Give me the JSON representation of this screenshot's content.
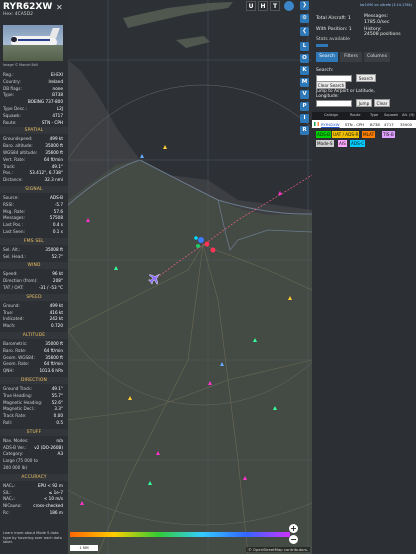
{
  "aircraft": {
    "callsign": "RYR62XW",
    "hex_label": "Hex:",
    "hex": "4CA5D2",
    "photo_credit": "Image © Marcel Brill"
  },
  "info_rows": [
    {
      "k": "Reg.:",
      "v": "EI-EXI"
    },
    {
      "k": "Country:",
      "v": "Ireland"
    },
    {
      "k": "DB flags:",
      "v": "none"
    },
    {
      "k": "Type:",
      "v": "B738"
    },
    {
      "k": "",
      "v": "BOEING 737-800"
    },
    {
      "k": "Type Desc.:",
      "v": "L2J"
    },
    {
      "k": "Squawk:",
      "v": "4717"
    },
    {
      "k": "Route:",
      "v": "STN - CPH"
    }
  ],
  "sections": {
    "spatial": {
      "title": "SPATIAL",
      "rows": [
        {
          "k": "Groundspeed:",
          "v": "499 kt"
        },
        {
          "k": "Baro. altitude:",
          "v": "35000 ft"
        },
        {
          "k": "WGS84 altitude:",
          "v": "35600 ft"
        },
        {
          "k": "Vert. Rate:",
          "v": "64 ft/min"
        },
        {
          "k": "Track:",
          "v": "49.1°"
        },
        {
          "k": "Pos.:",
          "v": "53.412°, 6.738°"
        },
        {
          "k": "Distance:",
          "v": "32.3 nmi"
        }
      ]
    },
    "signal": {
      "title": "SIGNAL",
      "rows": [
        {
          "k": "Source:",
          "v": "ADS-B"
        },
        {
          "k": "RSSI:",
          "v": "-5.7"
        },
        {
          "k": "Msg. Rate:",
          "v": "57.6"
        },
        {
          "k": "Messages:",
          "v": "57508"
        },
        {
          "k": "Last Pos.:",
          "v": "0.4 s"
        },
        {
          "k": "Last Seen:",
          "v": "0.1 s"
        }
      ]
    },
    "fms": {
      "title": "FMS SEL",
      "rows": [
        {
          "k": "Sel. Alt.:",
          "v": "35008 ft"
        },
        {
          "k": "Sel. Head.:",
          "v": "52.7°"
        }
      ]
    },
    "wind": {
      "title": "WIND",
      "rows": [
        {
          "k": "Speed:",
          "v": "96 kt"
        },
        {
          "k": "Direction (from):",
          "v": "208°"
        },
        {
          "k": "TAT / OAT:",
          "v": "-31 / -53 °C"
        }
      ]
    },
    "speed": {
      "title": "SPEED",
      "rows": [
        {
          "k": "Ground:",
          "v": "499 kt"
        },
        {
          "k": "True:",
          "v": "416 kt"
        },
        {
          "k": "Indicated:",
          "v": "242 kt"
        },
        {
          "k": "Mach:",
          "v": "0.720"
        }
      ]
    },
    "altitude": {
      "title": "ALTITUDE",
      "rows": [
        {
          "k": "Barometric:",
          "v": "35000 ft"
        },
        {
          "k": "Baro. Rate:",
          "v": "64 ft/min"
        },
        {
          "k": "Geom. WGS84:",
          "v": "35600 ft"
        },
        {
          "k": "Geom. Rate:",
          "v": "64 ft/min"
        },
        {
          "k": "QNH:",
          "v": "1013.6 hPa"
        }
      ]
    },
    "direction": {
      "title": "DIRECTION",
      "rows": [
        {
          "k": "Ground Track:",
          "v": "49.1°"
        },
        {
          "k": "True Heading:",
          "v": "55.7°"
        },
        {
          "k": "Magnetic Heading:",
          "v": "52.6°"
        },
        {
          "k": "Magnetic Decl.:",
          "v": "3.3°"
        },
        {
          "k": "Track Rate:",
          "v": "0.00"
        },
        {
          "k": "Roll:",
          "v": "0.5"
        }
      ]
    },
    "stuff": {
      "title": "STUFF",
      "rows": [
        {
          "k": "Nav. Modes:",
          "v": "n/a"
        },
        {
          "k": "ADS-B Ver.:",
          "v": "v2 (DO-260B)"
        },
        {
          "k": "Category:",
          "v": "A3"
        },
        {
          "k": "Large (75 000 to",
          "v": ""
        },
        {
          "k": "300 000 lb)",
          "v": ""
        }
      ]
    },
    "accuracy": {
      "title": "ACCURACY",
      "rows": [
        {
          "k": "NACₚ:",
          "v": "EPU < 92 m"
        },
        {
          "k": "SIL:",
          "v": "≤ 1e-7"
        },
        {
          "k": "NACᵥ:",
          "v": "< 10 m/s"
        },
        {
          "k": "NICʙᴀʀᴏ:",
          "v": "cross-checked"
        },
        {
          "k": "Rᴄ:",
          "v": "186 m"
        }
      ]
    }
  },
  "footer_note": "Learn more about Mode S data type by hovering over each data label.",
  "toolbar": {
    "u": "U",
    "h": "H",
    "t": "T",
    "chev_left": "❮",
    "chev_right": "❯"
  },
  "side_buttons": [
    "L",
    "O",
    "K",
    "M",
    "V",
    "P",
    "I",
    "R"
  ],
  "map": {
    "scale": "1 NM",
    "attribution": "© OpenStreetMap contributors.",
    "zoom_in": "+",
    "zoom_out": "−"
  },
  "rpanel": {
    "version": "tar1090 on ultrafe (3.14.1764)",
    "total_label": "Total Aircraft:",
    "total": "1",
    "pos_label": "With Position:",
    "pos": "1",
    "stats_label": "Stats available",
    "messages_label": "Messages:",
    "messages": "1785.0/sec",
    "history_label": "History:",
    "history": "24508 positions",
    "tabs": [
      "Search",
      "Filters",
      "Columns"
    ],
    "search_label": "Search:",
    "search_button": "Search",
    "clear_button": "Clear Search",
    "jump_label": "Jump to Airport or Latitude, Longitude:",
    "jump_button": "Jump",
    "clear2": "Clear",
    "table_headers": [
      "",
      "Callsign",
      "Route",
      "Type",
      "Squawk",
      "Alt. (ft)"
    ],
    "table_row": [
      "",
      "RYR62XW",
      "STN - CPH",
      "B738",
      "4717",
      "35000"
    ],
    "legend": [
      "ADS-B",
      "UAT / ADS-R",
      "MLAT",
      "TIS-B",
      "Mode-S",
      "AIS",
      "ADS-C"
    ],
    "legend_colors": [
      "#00d000",
      "#f0c000",
      "#ff8000",
      "#e0a0ff",
      "#cfcfcf",
      "#ffaaff",
      "#00ccff"
    ]
  }
}
